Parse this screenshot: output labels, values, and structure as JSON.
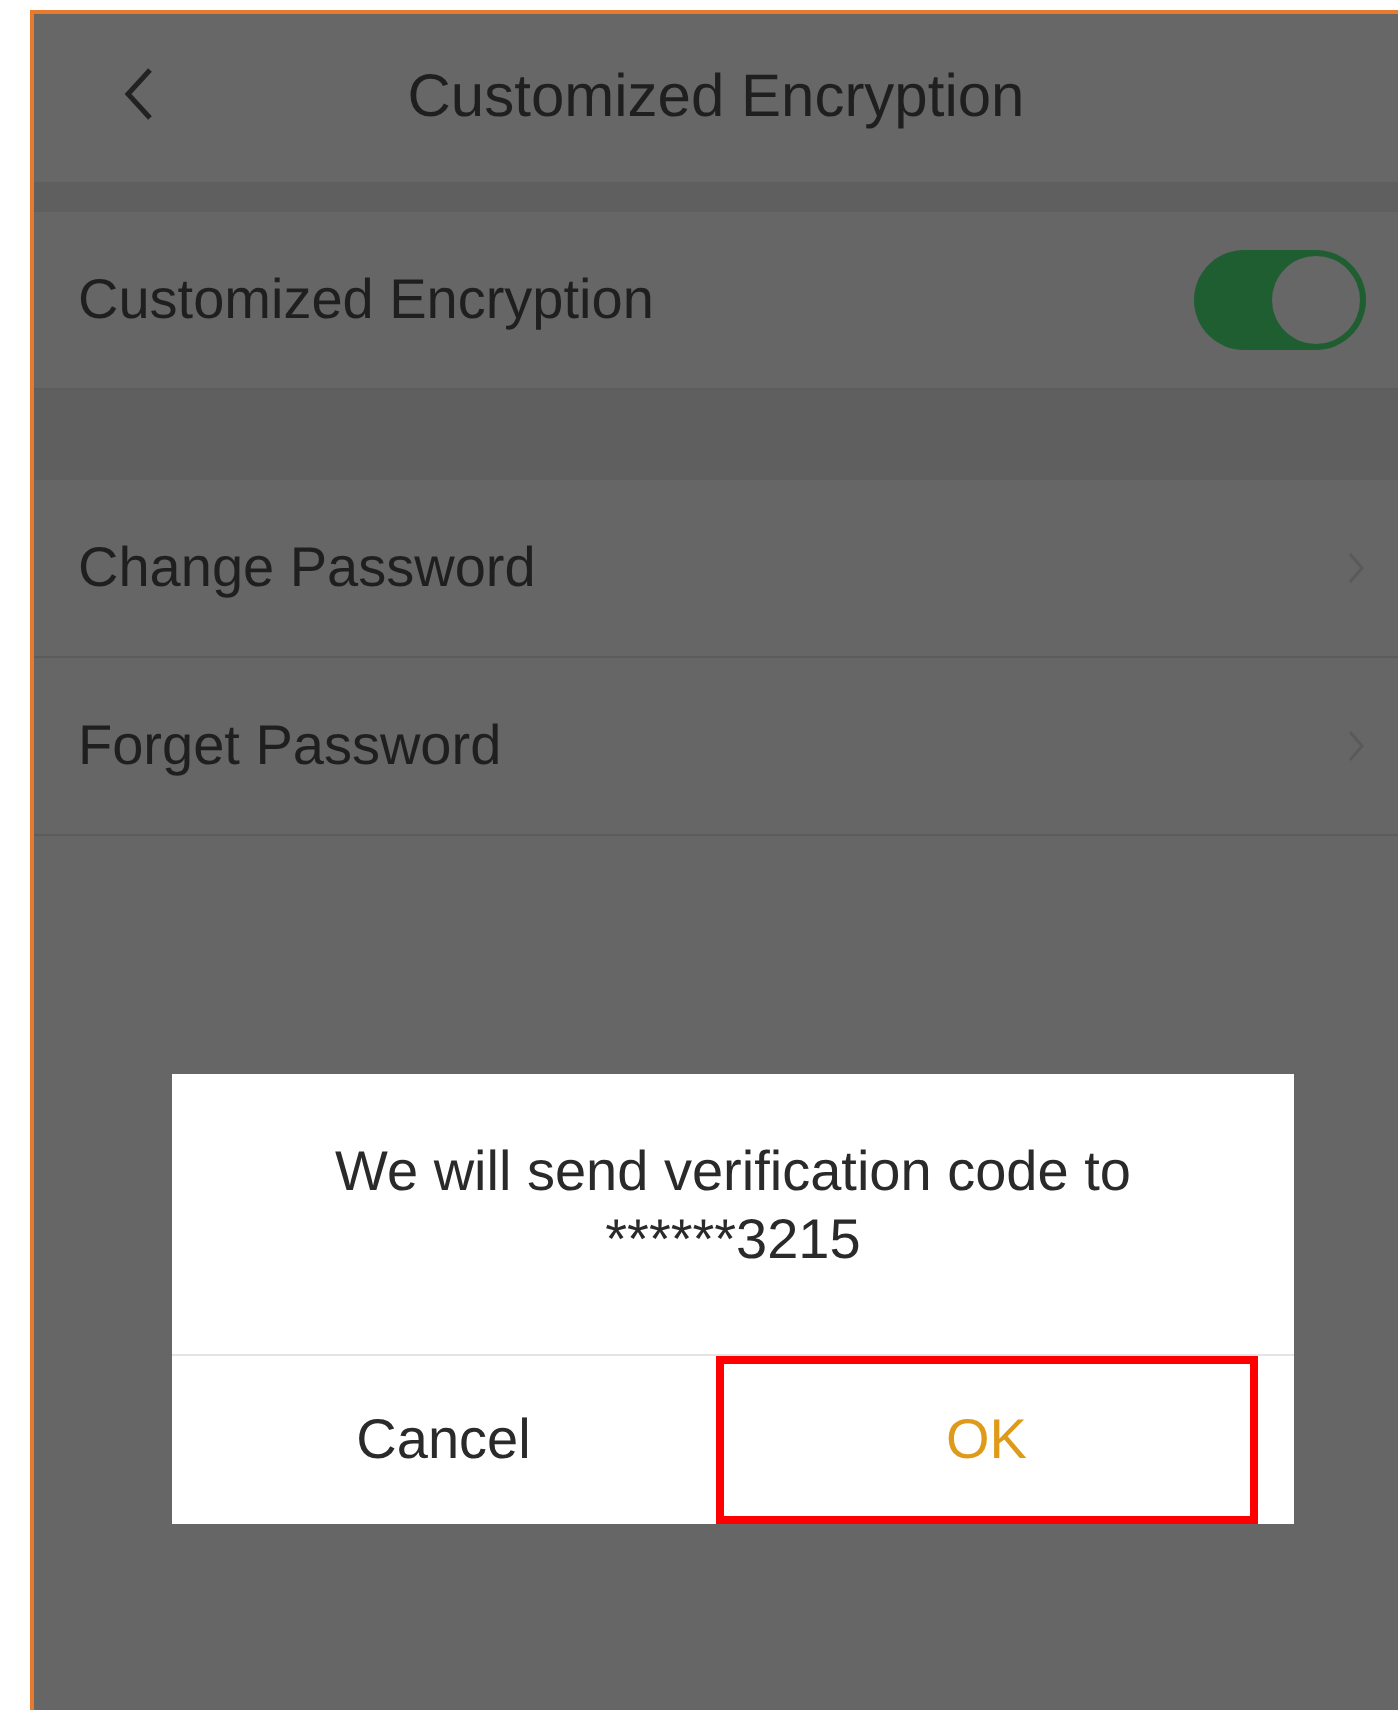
{
  "header": {
    "title": "Customized Encryption"
  },
  "toggle_row": {
    "label": "Customized Encryption",
    "on": true
  },
  "menu_items": [
    {
      "label": "Change Password"
    },
    {
      "label": "Forget Password"
    }
  ],
  "dialog": {
    "message": "We will send verification code to ******3215",
    "buttons": [
      {
        "label": "Cancel",
        "kind": "cancel",
        "highlighted": false
      },
      {
        "label": "OK",
        "kind": "primary",
        "highlighted": true
      }
    ]
  }
}
